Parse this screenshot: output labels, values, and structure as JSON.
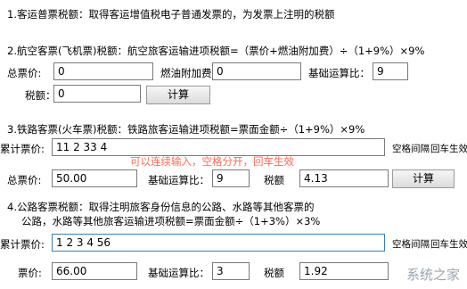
{
  "s1": {
    "title": "1.客运普票税额：取得客运增值税电子普通发票的，为发票上注明的税额"
  },
  "s2": {
    "title": "2.航空客票(飞机票)税额：航空旅客运输进项税额=（票价+燃油附加费）÷（1+9%）×9%",
    "total_label": "总票价:",
    "total_value": "0",
    "fuel_label": "燃油附加费：",
    "fuel_value": "0",
    "base_label": "基础运算比：",
    "base_value": "9",
    "tax_label": "税额：",
    "tax_value": "0",
    "calc_label": "计算"
  },
  "s3": {
    "title": "3.铁路客票(火车票)税额：铁路旅客运输进项税额=票面金额÷（1+9%）×9%",
    "sum_label": "累计票价:",
    "sum_value": "11 2 33 4",
    "sep_label": "空格间隔",
    "enter_label": "回车生效",
    "hint": "可以连续输入，空格分开，回车生效",
    "total_label": "总票价:",
    "total_value": "50.00",
    "base_label": "基础运算比：",
    "base_value": "9",
    "tax_label": "税额",
    "tax_value": "4.13",
    "calc_label": "计算"
  },
  "s4": {
    "title": "4.公路客票税额：取得注明旅客身份信息的公路、水路等其他客票的",
    "title2": "公路，水路等其他旅客运输进项税额=票面金额÷（1+3%）×3%",
    "sum_label": "累计票价:",
    "sum_value": "1 2 3 4  56",
    "sep_label": "空格间隔",
    "enter_label": "回车生效",
    "total_label": "票价:",
    "total_value": "66.00",
    "base_label": "基础运算比：",
    "base_value": "3",
    "tax_label": "税额",
    "tax_value": "1.92"
  },
  "watermark": "系统之家"
}
